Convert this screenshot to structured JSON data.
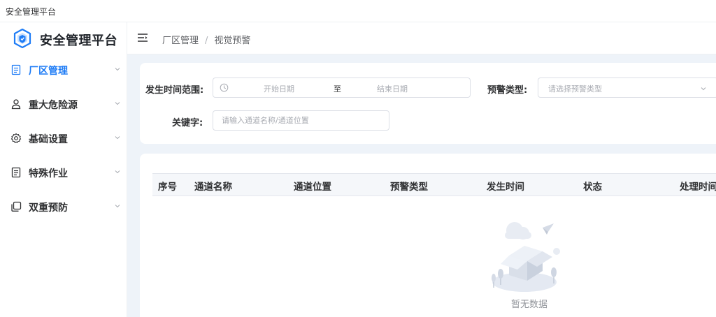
{
  "window": {
    "title": "安全管理平台"
  },
  "brand": {
    "name": "安全管理平台"
  },
  "colors": {
    "accent": "#1e7cf6",
    "content_bg": "#eef3f9",
    "table_header_bg": "#f5f7fa"
  },
  "sidebar": {
    "items": [
      {
        "label": "厂区管理",
        "icon": "document-icon",
        "active": true
      },
      {
        "label": "重大危险源",
        "icon": "user-icon",
        "active": false
      },
      {
        "label": "基础设置",
        "icon": "gear-icon",
        "active": false
      },
      {
        "label": "特殊作业",
        "icon": "document-icon",
        "active": false
      },
      {
        "label": "双重预防",
        "icon": "copy-icon",
        "active": false
      }
    ]
  },
  "header": {
    "breadcrumb": [
      "厂区管理",
      "视觉预警"
    ]
  },
  "filters": {
    "time_range_label": "发生时间范围:",
    "start_placeholder": "开始日期",
    "range_separator": "至",
    "end_placeholder": "结束日期",
    "warning_type_label": "预警类型:",
    "warning_type_placeholder": "请选择预警类型",
    "keyword_label": "关键字:",
    "keyword_placeholder": "请输入通道名称/通道位置"
  },
  "table": {
    "columns": [
      "序号",
      "通道名称",
      "通道位置",
      "预警类型",
      "发生时间",
      "状态",
      "处理时间"
    ],
    "rows": [],
    "empty_text": "暂无数据"
  }
}
